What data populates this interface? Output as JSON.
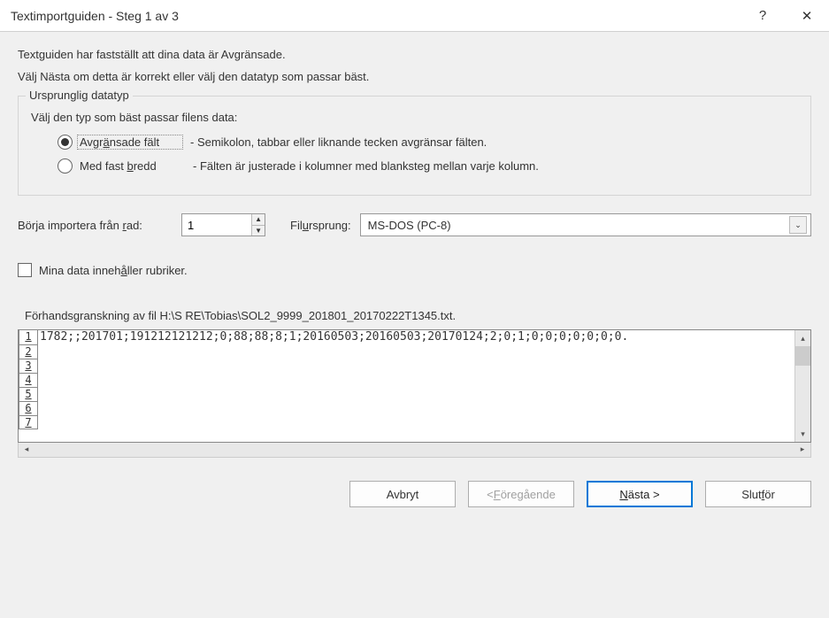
{
  "title": "Textimportguiden - Steg 1 av 3",
  "titlebar": {
    "help": "?",
    "close": "✕"
  },
  "intro1": "Textguiden har fastställt att dina data är Avgränsade.",
  "intro2": "Välj Nästa om detta är korrekt eller välj den datatyp som passar bäst.",
  "group": {
    "legend": "Ursprunglig datatyp",
    "instruction": "Välj den typ som bäst passar filens data:",
    "opt1": {
      "label_pre": "Avgr",
      "label_u": "ä",
      "label_post": "nsade fält",
      "desc": "- Semikolon, tabbar eller liknande tecken avgränsar fälten."
    },
    "opt2": {
      "label_pre": "Med fast ",
      "label_u": "b",
      "label_post": "redd",
      "desc": "- Fälten är justerade i kolumner med blanksteg mellan varje kolumn."
    }
  },
  "importRow": {
    "label_pre": "Börja importera från ",
    "label_u": "r",
    "label_post": "ad:",
    "value": "1",
    "originLabel": "Fil",
    "originLabel_u": "u",
    "originLabel_post": "rsprung:",
    "originValue": "MS-DOS (PC-8)"
  },
  "headers": {
    "pre": "Mina data inneh",
    "u": "å",
    "post": "ller rubriker."
  },
  "preview": {
    "label": "Förhandsgranskning av fil H:\\S RE\\Tobias\\SOL2_9999_201801_20170222T1345.txt.",
    "rows": [
      "1",
      "2",
      "3",
      "4",
      "5",
      "6",
      "7"
    ],
    "line1": "1782;;201701;191212121212;0;88;88;8;1;20160503;20160503;20170124;2;0;1;0;0;0;0;0;0;0."
  },
  "buttons": {
    "cancel": "Avbryt",
    "back_pre": "< ",
    "back_u": "F",
    "back_post": "öregående",
    "next_u": "N",
    "next_post": "ästa >",
    "finish_pre": "Slut",
    "finish_u": "f",
    "finish_post": "ör"
  }
}
